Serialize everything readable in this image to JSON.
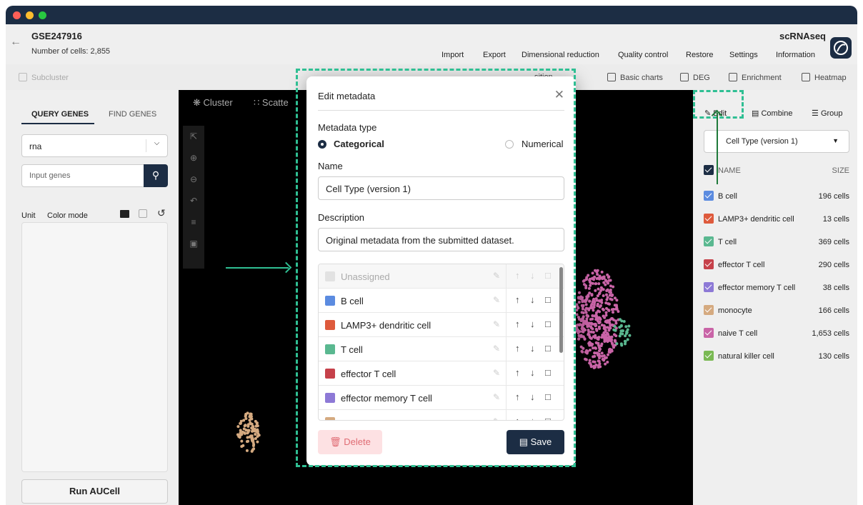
{
  "header": {
    "dataset_title": "GSE247916",
    "cell_count": "Number of cells: 2,855",
    "app_name": "scRNAseq",
    "menu": [
      "Import",
      "Export",
      "Dimensional reduction",
      "Quality control",
      "Restore",
      "Settings",
      "Information"
    ]
  },
  "toolbar": {
    "subcluster": "Subcluster",
    "items": [
      "Composition",
      "Basic charts",
      "DEG",
      "Enrichment",
      "Heatmap"
    ],
    "composition_visible": "sition"
  },
  "left_panel": {
    "tab_query": "QUERY GENES",
    "tab_find": "FIND GENES",
    "assay_value": "rna",
    "gene_placeholder": "Input genes",
    "unit_label": "Unit",
    "color_mode_label": "Color mode",
    "run_button": "Run AUCell"
  },
  "canvas": {
    "tool_cluster": "Cluster",
    "tool_scatter": "Scatte"
  },
  "right_panel": {
    "edit": "Edit",
    "combine": "Combine",
    "group": "Group",
    "selected_metadata": "Cell Type (version 1)",
    "col_name": "NAME",
    "col_size": "SIZE",
    "groups": [
      {
        "name": "B cell",
        "size": "196 cells",
        "color": "#5b8be0"
      },
      {
        "name": "LAMP3+ dendritic cell",
        "size": "13 cells",
        "color": "#de5a3c"
      },
      {
        "name": "T cell",
        "size": "369 cells",
        "color": "#5ab890"
      },
      {
        "name": "effector T cell",
        "size": "290 cells",
        "color": "#c6414a"
      },
      {
        "name": "effector memory T cell",
        "size": "38 cells",
        "color": "#8d79d6"
      },
      {
        "name": "monocyte",
        "size": "166 cells",
        "color": "#d5aa80"
      },
      {
        "name": "naive T cell",
        "size": "1,653 cells",
        "color": "#c964a7"
      },
      {
        "name": "natural killer cell",
        "size": "130 cells",
        "color": "#7ab953"
      }
    ]
  },
  "modal": {
    "title": "Edit metadata",
    "metadata_type_label": "Metadata type",
    "type_categorical": "Categorical",
    "type_numerical": "Numerical",
    "name_label": "Name",
    "name_value": "Cell Type (version 1)",
    "description_label": "Description",
    "description_value": "Original metadata from the submitted dataset.",
    "categories": [
      {
        "label": "Unassigned",
        "color": "#e2e2e2",
        "disabled": true
      },
      {
        "label": "B cell",
        "color": "#5b8be0"
      },
      {
        "label": "LAMP3+ dendritic cell",
        "color": "#de5a3c"
      },
      {
        "label": "T cell",
        "color": "#5ab890"
      },
      {
        "label": "effector T cell",
        "color": "#c6414a"
      },
      {
        "label": "effector memory T cell",
        "color": "#8d79d6"
      },
      {
        "label": "",
        "color": "#d5aa80"
      }
    ],
    "delete_button": "Delete",
    "save_button": "Save"
  },
  "colors": {
    "brand_dark": "#1c2d44",
    "highlight": "#2fbf93",
    "arrow_green": "#1f7a3a"
  }
}
